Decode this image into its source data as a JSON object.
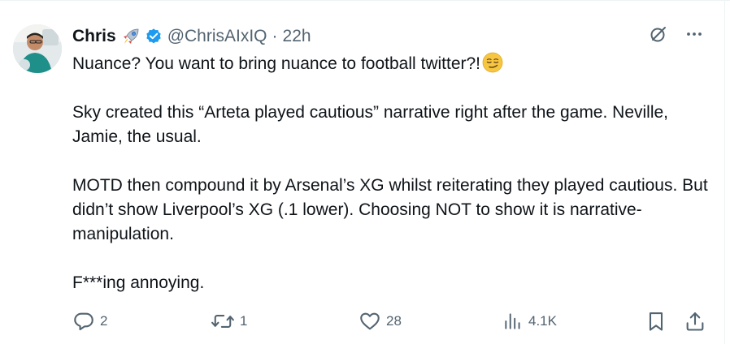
{
  "tweet": {
    "author": {
      "name": "Chris",
      "handle": "@ChrisAIxIQ",
      "separator": "·",
      "time": "22h",
      "name_emoji_icon": "rocket-icon",
      "badge_icon": "verified-badge-icon"
    },
    "paragraphs": [
      "Nuance? You want to bring nuance to football twitter?!",
      "Sky created this “Arteta played cautious” narrative right after the game. Neville, Jamie, the usual.",
      "MOTD then compound it by Arsenal’s XG whilst reiterating they played cautious. But didn’t show Liverpool’s XG (.1 lower). Choosing NOT to show it is narrative-manipulation.",
      "F***ing annoying."
    ],
    "first_paragraph_emoji_icon": "smirking-face-icon",
    "actions": {
      "replies": "2",
      "reposts": "1",
      "likes": "28",
      "views": "4.1K"
    }
  },
  "colors": {
    "text": "#0f1419",
    "secondary": "#536471",
    "verified": "#1d9bf0",
    "divider": "#eff3f4"
  }
}
